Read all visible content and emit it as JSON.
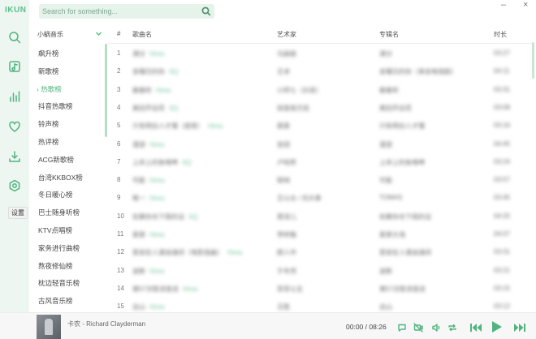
{
  "app": {
    "logo": "IKUN"
  },
  "search": {
    "placeholder": "Search for something..."
  },
  "window": {
    "minimize": "–",
    "close": "×"
  },
  "sidebar": {
    "icons": [
      "search-icon",
      "music-library-icon",
      "chart-icon",
      "heart-icon",
      "download-icon",
      "settings-icon"
    ],
    "tooltip": "设置"
  },
  "list": {
    "source": "小蜗音乐",
    "items": [
      "飙升榜",
      "新歌榜",
      "热歌榜",
      "抖音热歌榜",
      "铃声榜",
      "热评榜",
      "ACG新歌榜",
      "台湾KKBOX榜",
      "冬日暖心榜",
      "巴士随身听榜",
      "KTV点唱榜",
      "家务进行曲榜",
      "熬夜修仙榜",
      "枕边轻音乐榜",
      "古风音乐榜"
    ],
    "active_index": 2
  },
  "table": {
    "headers": {
      "num": "#",
      "title": "歌曲名",
      "artist": "艺术家",
      "album": "专辑名",
      "duration": "时长"
    },
    "rows": [
      {
        "num": "1",
        "title": "满分",
        "tag": "Hires",
        "artist": "马赫赫",
        "album": "满分",
        "duration": "03:27"
      },
      {
        "num": "2",
        "title": "金曜日的你",
        "tag": "SQ",
        "artist": "王卓",
        "album": "金曜日的你（来自电视剧）",
        "duration": "04:11"
      },
      {
        "num": "3",
        "title": "敢敢听",
        "tag": "Hires",
        "artist": "小阿七（抖音）",
        "album": "敢敢听",
        "duration": "03:31"
      },
      {
        "num": "4",
        "title": "离别开出花",
        "tag": "SQ",
        "artist": "就是南方凯",
        "album": "离别开出花",
        "duration": "03:08"
      },
      {
        "num": "5",
        "title": "只有明白人才懂（感恩）",
        "tag": "Hires",
        "artist": "蔡蔡",
        "album": "只有明白人才懂",
        "duration": "03:16"
      },
      {
        "num": "6",
        "title": "漫游",
        "tag": "Hires",
        "artist": "张钥",
        "album": "漫游",
        "duration": "04:45"
      },
      {
        "num": "7",
        "title": "上岸上的鱼喝啤",
        "tag": "SQ",
        "artist": "卢昭昇",
        "album": "上岸上的鱼喝啤",
        "duration": "03:24"
      },
      {
        "num": "8",
        "title": "可能",
        "tag": "Hires",
        "artist": "程响",
        "album": "可能",
        "duration": "03:57"
      },
      {
        "num": "9",
        "title": "唯一",
        "tag": "Hires",
        "artist": "王以太 / 刘大拿",
        "album": "TOMAS",
        "duration": "03:45"
      },
      {
        "num": "10",
        "title": "如果你也下雨的话",
        "tag": "SQ",
        "artist": "周深儿",
        "album": "如果你也下雨的话",
        "duration": "04:25"
      },
      {
        "num": "11",
        "title": "星辰",
        "tag": "Hires",
        "artist": "李昕融",
        "album": "星辰大海",
        "duration": "04:07"
      },
      {
        "num": "12",
        "title": "爱就在人潮汹涌间（电影插曲）",
        "tag": "Hires",
        "artist": "颜人中",
        "album": "爱就在人潮汹涌间",
        "duration": "03:31"
      },
      {
        "num": "13",
        "title": "波斯",
        "tag": "Hires",
        "artist": "于冬然",
        "album": "波斯",
        "duration": "03:21"
      },
      {
        "num": "14",
        "title": "第57次取消发送",
        "tag": "Hires",
        "artist": "菲菲公主",
        "album": "第57次取消发送",
        "duration": "03:15"
      },
      {
        "num": "15",
        "title": "出山",
        "tag": "Hires",
        "artist": "王胜",
        "album": "出山",
        "duration": "03:12"
      }
    ]
  },
  "player": {
    "track": "卡农 - Richard Clayderman",
    "current": "00:00",
    "separator": "/",
    "total": "08:26",
    "accent": "#4fb47f"
  }
}
